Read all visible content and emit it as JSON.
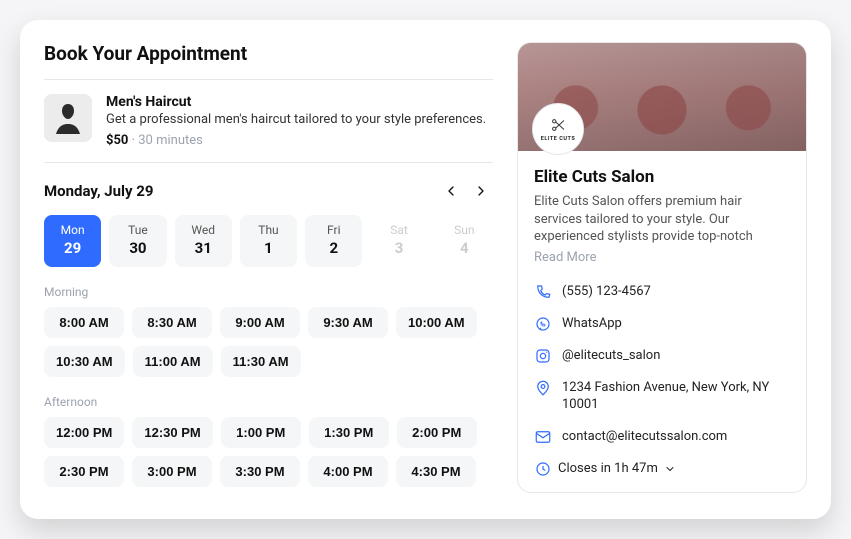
{
  "header": {
    "title": "Book Your Appointment"
  },
  "service": {
    "title": "Men's Haircut",
    "description": "Get a professional men's haircut tailored to your style preferences.",
    "price": "$50",
    "duration": "30 minutes"
  },
  "calendar": {
    "current_label": "Monday, July 29",
    "days": [
      {
        "dow": "Mon",
        "num": "29",
        "state": "active"
      },
      {
        "dow": "Tue",
        "num": "30",
        "state": "normal"
      },
      {
        "dow": "Wed",
        "num": "31",
        "state": "normal"
      },
      {
        "dow": "Thu",
        "num": "1",
        "state": "normal"
      },
      {
        "dow": "Fri",
        "num": "2",
        "state": "normal"
      },
      {
        "dow": "Sat",
        "num": "3",
        "state": "disabled"
      },
      {
        "dow": "Sun",
        "num": "4",
        "state": "disabled"
      }
    ],
    "groups": [
      {
        "label": "Morning",
        "slots": [
          "8:00 AM",
          "8:30 AM",
          "9:00 AM",
          "9:30 AM",
          "10:00 AM",
          "10:30 AM",
          "11:00 AM",
          "11:30 AM"
        ]
      },
      {
        "label": "Afternoon",
        "slots": [
          "12:00 PM",
          "12:30 PM",
          "1:00 PM",
          "1:30 PM",
          "2:00 PM",
          "2:30 PM",
          "3:00 PM",
          "3:30 PM",
          "4:00 PM",
          "4:30 PM"
        ]
      }
    ]
  },
  "salon": {
    "logo_text": "ELITE CUTS",
    "name": "Elite Cuts Salon",
    "description": "Elite Cuts Salon offers premium hair services tailored to your style. Our experienced stylists provide top-notch",
    "read_more": "Read More",
    "phone": "(555) 123-4567",
    "whatsapp": "WhatsApp",
    "instagram": "@elitecuts_salon",
    "address": "1234 Fashion Avenue, New York, NY 10001",
    "email": "contact@elitecutssalon.com",
    "hours": "Closes in 1h 47m"
  }
}
